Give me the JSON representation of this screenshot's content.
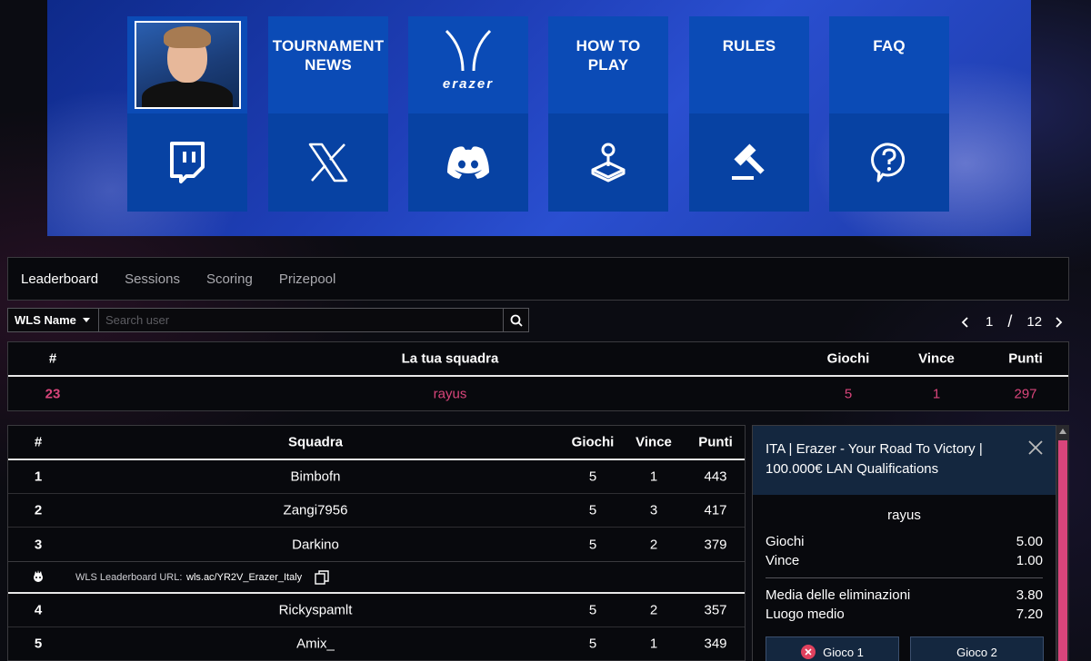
{
  "banner": {
    "tiles": [
      {
        "top_label": "",
        "bottom_icon": "twitch-icon"
      },
      {
        "top_label_line1": "TOURNAMENT",
        "top_label_line2": "NEWS",
        "bottom_icon": "x-icon"
      },
      {
        "logo_text": "erazer",
        "bottom_icon": "discord-icon"
      },
      {
        "top_label_line1": "HOW TO",
        "top_label_line2": "PLAY",
        "bottom_icon": "joystick-icon"
      },
      {
        "top_label_line1": "RULES",
        "bottom_icon": "gavel-icon"
      },
      {
        "top_label_line1": "FAQ",
        "bottom_icon": "question-icon"
      }
    ]
  },
  "tabs": [
    "Leaderboard",
    "Sessions",
    "Scoring",
    "Prizepool"
  ],
  "filter": {
    "select_value": "WLS Name",
    "search_placeholder": "Search user"
  },
  "pager": {
    "current": "1",
    "separator": "/",
    "total": "12"
  },
  "my_team": {
    "headers": {
      "rank": "#",
      "team": "La tua squadra",
      "games": "Giochi",
      "wins": "Vince",
      "points": "Punti"
    },
    "row": {
      "rank": "23",
      "team": "rayus",
      "games": "5",
      "wins": "1",
      "points": "297"
    }
  },
  "leaderboard": {
    "headers": {
      "rank": "#",
      "team": "Squadra",
      "games": "Giochi",
      "wins": "Vince",
      "points": "Punti"
    },
    "rows": [
      {
        "rank": "1",
        "team": "Bimbofn",
        "games": "5",
        "wins": "1",
        "points": "443"
      },
      {
        "rank": "2",
        "team": "Zangi7956",
        "games": "5",
        "wins": "3",
        "points": "417"
      },
      {
        "rank": "3",
        "team": "Darkino",
        "games": "5",
        "wins": "2",
        "points": "379"
      },
      {
        "rank": "4",
        "team": "Rickyspamlt",
        "games": "5",
        "wins": "2",
        "points": "357"
      },
      {
        "rank": "5",
        "team": "Amix_",
        "games": "5",
        "wins": "1",
        "points": "349"
      }
    ],
    "url_label": "WLS Leaderboard URL:",
    "url_value": "wls.ac/YR2V_Erazer_Italy"
  },
  "side_panel": {
    "title": "ITA | Erazer - Your Road To Victory | 100.000€ LAN Qualifications",
    "player": "rayus",
    "stats": [
      {
        "label": "Giochi",
        "value": "5.00"
      },
      {
        "label": "Vince",
        "value": "1.00"
      }
    ],
    "stats2": [
      {
        "label": "Media delle eliminazioni",
        "value": "3.80"
      },
      {
        "label": "Luogo medio",
        "value": "7.20"
      }
    ],
    "buttons": [
      "Gioco 1",
      "Gioco 2"
    ]
  },
  "colors": {
    "accent_pink": "#d9457b",
    "tile_blue": "#0b4bb6",
    "panel_header": "#14273f"
  }
}
